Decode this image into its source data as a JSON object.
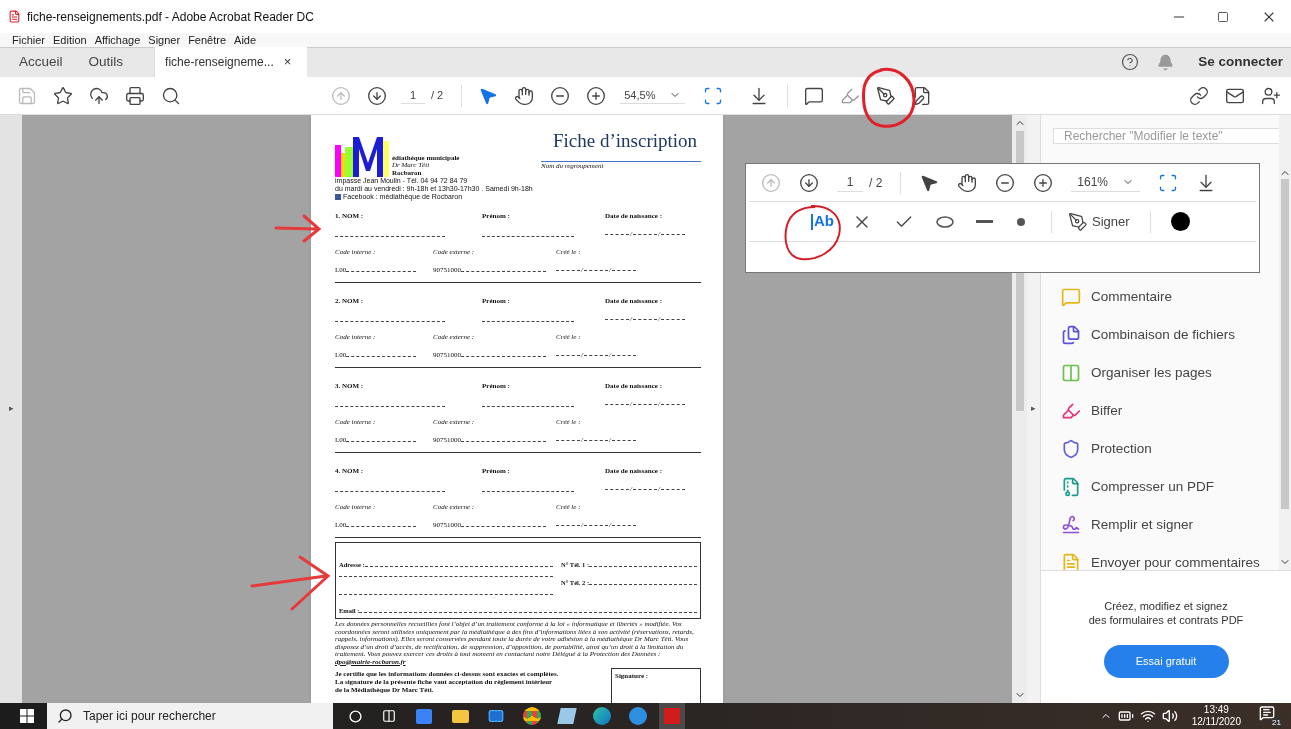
{
  "window": {
    "title": "fiche-renseignements.pdf - Adobe Acrobat Reader DC"
  },
  "menu": [
    {
      "label": "Fichier"
    },
    {
      "label": "Edition"
    },
    {
      "label": "Affichage"
    },
    {
      "label": "Signer"
    },
    {
      "label": "Fenêtre"
    },
    {
      "label": "Aide"
    }
  ],
  "tabs": [
    {
      "label": "Accueil",
      "selected": false
    },
    {
      "label": "Outils",
      "selected": false
    },
    {
      "label": "fiche-renseigneme...",
      "selected": true,
      "close": "×"
    }
  ],
  "panes": {
    "left_handle": "▸",
    "right_handle": "▸"
  },
  "account": {
    "label": "Se connecter"
  },
  "toolbar": {
    "page": "1",
    "page_count": "/ 2",
    "zoom": "54,5%"
  },
  "document": {
    "logo": {
      "name": "édiathèque municipale",
      "director": "Dr Marc Téti",
      "town": "Rocbaron",
      "address": "impasse Jean Moulin - Tél. 04 94 72 84 79",
      "hours": "du mardi au vendredi : 9h-18h et 13h30-17h30 . Samedi 9h-18h",
      "facebook": "Facebook : médiathèque de Rocbaron"
    },
    "title": "Fiche d’inscription",
    "group_label": "Nom du regroupement",
    "date_sep": "/",
    "records": [
      {
        "nom": "1. NOM :",
        "prenom": "Prénom :",
        "naissance": "Date de naissance :",
        "code_interne": "Code interne :",
        "code_externe": "Code externe :",
        "cree": "Créé le :",
        "interne_value": "L00",
        "externe_value": "90751000"
      },
      {
        "nom": "2. NOM :",
        "prenom": "Prénom :",
        "naissance": "Date de naissance :",
        "code_interne": "Code interne :",
        "code_externe": "Code externe :",
        "cree": "Créé le :",
        "interne_value": "L00",
        "externe_value": "90751000"
      },
      {
        "nom": "3. NOM :",
        "prenom": "Prénom :",
        "naissance": "Date de naissance :",
        "code_interne": "Code interne :",
        "code_externe": "Code externe :",
        "cree": "Créé le :",
        "interne_value": "L00",
        "externe_value": "90751000"
      },
      {
        "nom": "4. NOM :",
        "prenom": "Prénom :",
        "naissance": "Date de naissance :",
        "code_interne": "Code interne :",
        "code_externe": "Code externe :",
        "cree": "Créé le :",
        "interne_value": "L00",
        "externe_value": "90751000"
      }
    ],
    "contact": {
      "address": "Adresse :",
      "tel1": "N° Tél. 1 :",
      "tel2": "N° Tél. 2 :",
      "email": "Email :"
    },
    "privacy": "Les données personnelles recueillies font l’objet d’un traitement conforme à la loi « informatique et libertés » modifiée. Vos coordonnées seront utilisées uniquement par la médiathèque à des fins d’informations liées à son activité (réservations, retards, rappels, informations). Elles seront conservées pendant toute la durée de votre adhésion à la médiathèque Dr Marc Téti. Vous disposez d’un droit d’accès, de rectification, de suppression, d’opposition, de portabilité, ainsi qu’un droit à la limitation du traitement. Vous pouvez exercer ces droits à tout moment en contactant notre Délégué à la Protection des Données :",
    "privacy_link": "dpo@mairie-rocbaron.fr",
    "certify": [
      "Je certifie que les informations données ci-dessus sont exactes et complètes.",
      "La signature de la présente fiche vaut acceptation du règlement intérieur",
      "de la Médiathèque Dr Marc Téti."
    ],
    "signature": "Signature :"
  },
  "floating_toolbar": {
    "page": "1",
    "page_count": "/ 2",
    "zoom": "161%",
    "text_tool": "Ab",
    "sign": "Signer",
    "color": "#000000"
  },
  "side_panel": {
    "search_placeholder": "Rechercher \"Modifier le texte\"",
    "tools": [
      {
        "label": "Commentaire",
        "kind": "comment",
        "color": "#e6b619"
      },
      {
        "label": "Combinaison de fichiers",
        "kind": "combine",
        "color": "#5b4fd8"
      },
      {
        "label": "Organiser les pages",
        "kind": "organize",
        "color": "#6cbf4a"
      },
      {
        "label": "Biffer",
        "kind": "redact",
        "color": "#e0367a"
      },
      {
        "label": "Protection",
        "kind": "protect",
        "color": "#5d60d6"
      },
      {
        "label": "Compresser un PDF",
        "kind": "compress",
        "color": "#1f9a8c"
      },
      {
        "label": "Remplir et signer",
        "kind": "sign",
        "color": "#8c52d8"
      },
      {
        "label": "Envoyer pour commentaires",
        "kind": "send",
        "color": "#e6b619"
      }
    ],
    "promo": [
      "Créez, modifiez et signez",
      "des formulaires et contrats PDF"
    ],
    "trial": "Essai gratuit"
  },
  "taskbar": {
    "search": "Taper ici pour rechercher",
    "time": "13:49",
    "date": "12/11/2020",
    "notifications": "21"
  }
}
